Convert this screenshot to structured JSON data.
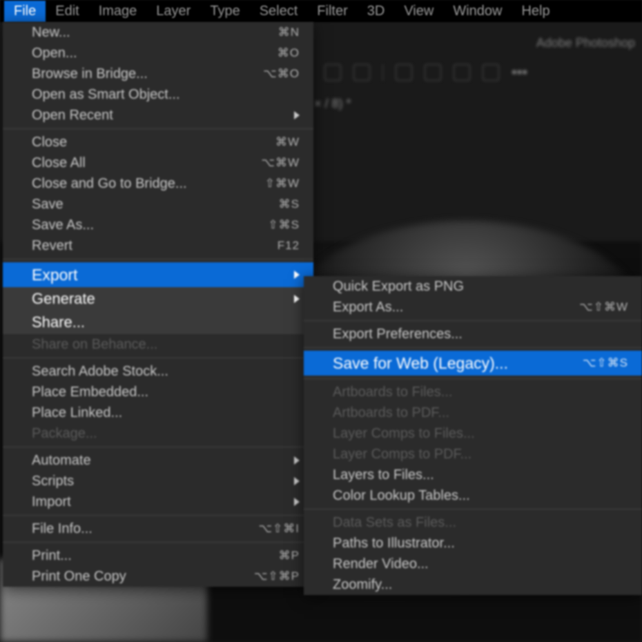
{
  "app_title": "Adobe Photoshop",
  "menubar": [
    "File",
    "Edit",
    "Image",
    "Layer",
    "Type",
    "Select",
    "Filter",
    "3D",
    "View",
    "Window",
    "Help"
  ],
  "menubar_active": 0,
  "file_menu": {
    "groups": [
      [
        {
          "label": "New...",
          "shortcut": "⌘N"
        },
        {
          "label": "Open...",
          "shortcut": "⌘O"
        },
        {
          "label": "Browse in Bridge...",
          "shortcut": "⌥⌘O"
        },
        {
          "label": "Open as Smart Object..."
        },
        {
          "label": "Open Recent",
          "submenu": true
        }
      ],
      [
        {
          "label": "Close",
          "shortcut": "⌘W"
        },
        {
          "label": "Close All",
          "shortcut": "⌥⌘W"
        },
        {
          "label": "Close and Go to Bridge...",
          "shortcut": "⇧⌘W"
        },
        {
          "label": "Save",
          "shortcut": "⌘S"
        },
        {
          "label": "Save As...",
          "shortcut": "⇧⌘S"
        },
        {
          "label": "Revert",
          "shortcut": "F12"
        }
      ],
      [
        {
          "label": "Export",
          "submenu": true,
          "highlight": true
        },
        {
          "label": "Generate",
          "submenu": true,
          "focus": true
        },
        {
          "label": "Share...",
          "focus": true
        },
        {
          "label": "Share on Behance...",
          "disabled": true
        }
      ],
      [
        {
          "label": "Search Adobe Stock..."
        },
        {
          "label": "Place Embedded..."
        },
        {
          "label": "Place Linked..."
        },
        {
          "label": "Package...",
          "disabled": true
        }
      ],
      [
        {
          "label": "Automate",
          "submenu": true
        },
        {
          "label": "Scripts",
          "submenu": true
        },
        {
          "label": "Import",
          "submenu": true
        }
      ],
      [
        {
          "label": "File Info...",
          "shortcut": "⌥⇧⌘I"
        }
      ],
      [
        {
          "label": "Print...",
          "shortcut": "⌘P"
        },
        {
          "label": "Print One Copy",
          "shortcut": "⌥⇧⌘P"
        }
      ]
    ]
  },
  "export_menu": {
    "groups": [
      [
        {
          "label": "Quick Export as PNG"
        },
        {
          "label": "Export As...",
          "shortcut": "⌥⇧⌘W"
        }
      ],
      [
        {
          "label": "Export Preferences..."
        }
      ],
      [
        {
          "label": "Save for Web (Legacy)...",
          "shortcut": "⌥⇧⌘S",
          "highlight": true
        }
      ],
      [
        {
          "label": "Artboards to Files...",
          "disabled": true
        },
        {
          "label": "Artboards to PDF...",
          "disabled": true
        },
        {
          "label": "Layer Comps to Files...",
          "disabled": true
        },
        {
          "label": "Layer Comps to PDF...",
          "disabled": true
        },
        {
          "label": "Layers to Files..."
        },
        {
          "label": "Color Lookup Tables..."
        }
      ],
      [
        {
          "label": "Data Sets as Files...",
          "disabled": true
        },
        {
          "label": "Paths to Illustrator..."
        },
        {
          "label": "Render Video..."
        },
        {
          "label": "Zoomify..."
        }
      ]
    ]
  }
}
